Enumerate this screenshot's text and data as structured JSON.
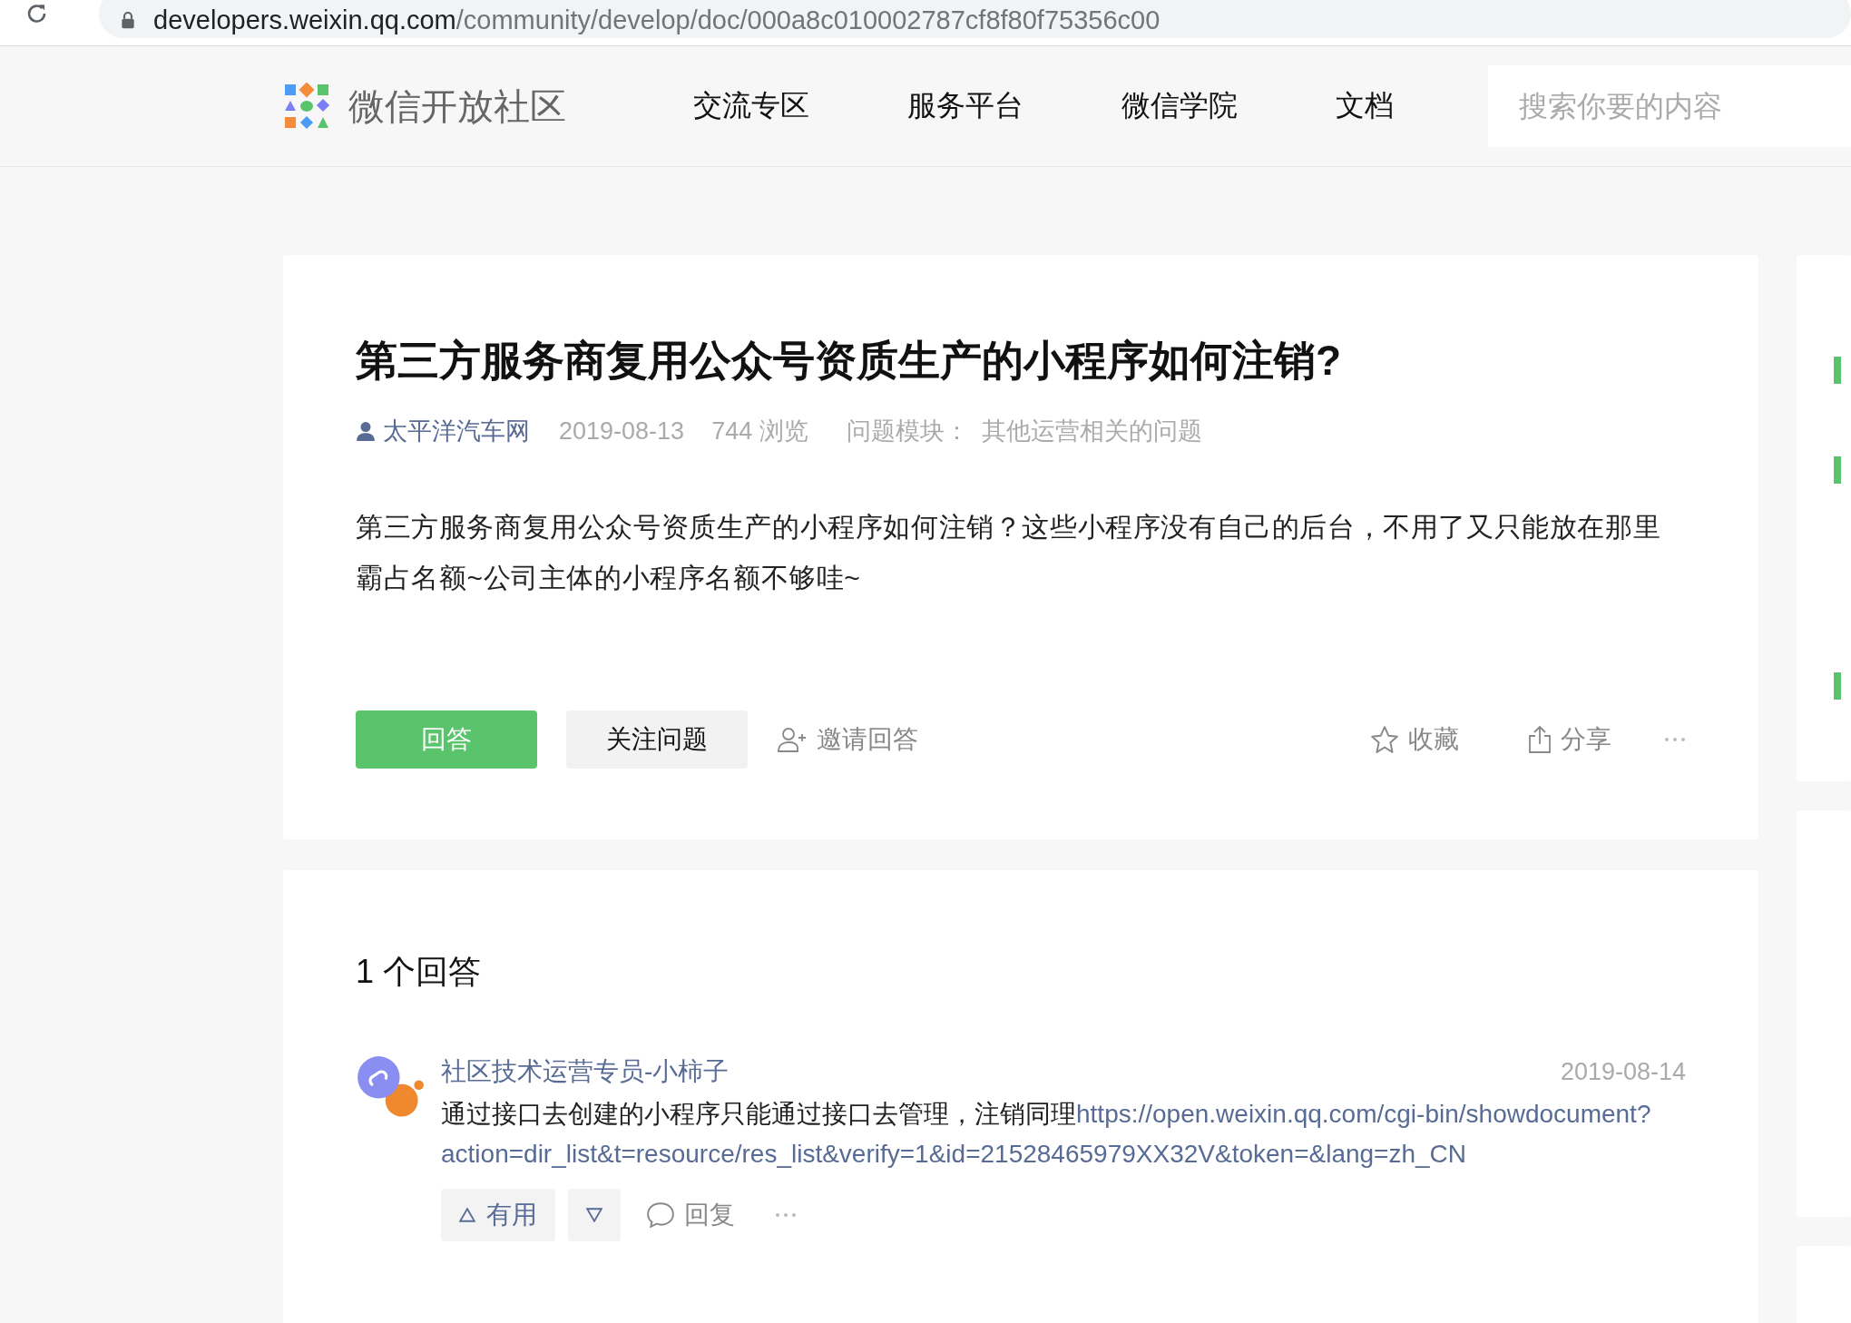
{
  "browser": {
    "url_host": "developers.weixin.qq.com",
    "url_path": "/community/develop/doc/000a8c010002787cf8f80f75356c00"
  },
  "header": {
    "logo_text": "微信开放社区",
    "nav": [
      {
        "label": "交流专区"
      },
      {
        "label": "服务平台"
      },
      {
        "label": "微信学院"
      },
      {
        "label": "文档"
      }
    ],
    "search": {
      "placeholder": "搜索你要的内容"
    }
  },
  "question": {
    "title": "第三方服务商复用公众号资质生产的小程序如何注销?",
    "author": "太平洋汽车网",
    "date": "2019-08-13",
    "views": "744 浏览",
    "module_label": "问题模块：",
    "module": "其他运营相关的问题",
    "body": "第三方服务商复用公众号资质生产的小程序如何注销？这些小程序没有自己的后台，不用了又只能放在那里霸占名额~公司主体的小程序名额不够哇~",
    "actions": {
      "answer": "回答",
      "follow": "关注问题",
      "invite": "邀请回答",
      "favorite": "收藏",
      "share": "分享"
    }
  },
  "answers": {
    "count_label": "1 个回答",
    "items": [
      {
        "author": "社区技术运营专员-小柿子",
        "date": "2019-08-14",
        "text": "通过接口去创建的小程序只能通过接口去管理，注销同理",
        "link_parts": [
          "https://open.weixin.qq.com/cgi-bin/showdocument?",
          "action=dir_list&t=resource/res_list&verify=1&id=21528465979XX32V&token=&lang=zh_CN"
        ],
        "useful": "有用",
        "reply": "回复"
      }
    ]
  }
}
